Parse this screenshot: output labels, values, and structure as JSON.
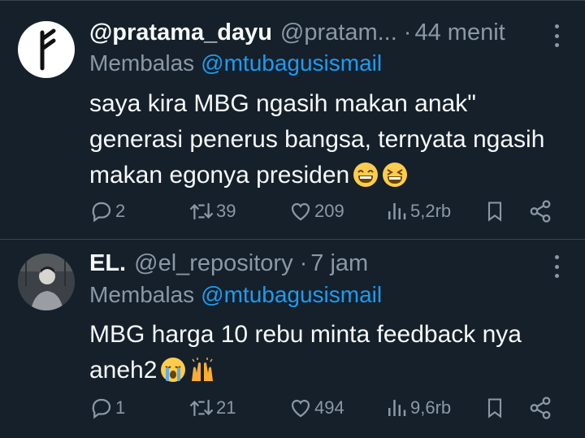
{
  "colors": {
    "background": "#15202b",
    "text": "#f7f9f9",
    "muted": "#8b98a5",
    "link": "#1d9bf0",
    "divider": "#38444d"
  },
  "tweets": [
    {
      "display_name": "@pratama_dayu",
      "handle": "@pratam...",
      "separator": "·",
      "time": "44 menit",
      "reply_prefix": "Membalas",
      "reply_to": "@mtubagusismail",
      "text_lines": [
        "saya kira MBG ngasih makan anak\"",
        "generasi penerus bangsa, ternyata ngasih",
        "makan egonya presiden"
      ],
      "emojis": [
        "grinning-face-icon",
        "grinning-squinting-face-icon"
      ],
      "avatar_icon": "rune-logo-icon",
      "stats": {
        "replies": "2",
        "reposts": "39",
        "likes": "209",
        "views": "5,2rb"
      }
    },
    {
      "display_name": "EL.",
      "handle": "@el_repository",
      "separator": "·",
      "time": "7 jam",
      "reply_prefix": "Membalas",
      "reply_to": "@mtubagusismail",
      "text_lines": [
        "MBG harga 10 rebu minta feedback nya",
        "aneh2"
      ],
      "emojis": [
        "loudly-crying-face-icon",
        "raising-hands-icon"
      ],
      "avatar_icon": "profile-photo-icon",
      "stats": {
        "replies": "1",
        "reposts": "21",
        "likes": "494",
        "views": "9,6rb"
      }
    }
  ]
}
